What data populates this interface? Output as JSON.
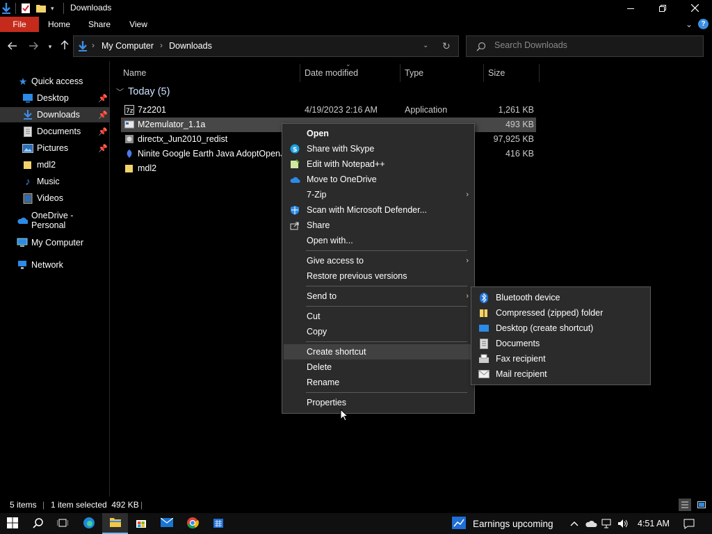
{
  "window": {
    "title": "Downloads",
    "minimize_icon": "minimize-icon",
    "maximize_icon": "restore-icon",
    "close_icon": "close-icon"
  },
  "ribbon": {
    "tabs": [
      "File",
      "Home",
      "Share",
      "View"
    ],
    "file_tab_color": "#c42b1c"
  },
  "address": {
    "crumbs": [
      "My Computer",
      "Downloads"
    ],
    "search_placeholder": "Search Downloads"
  },
  "sidebar": {
    "items": [
      {
        "label": "Quick access",
        "icon": "star-icon",
        "pinned": false
      },
      {
        "label": "Desktop",
        "icon": "desktop-icon",
        "pinned": true
      },
      {
        "label": "Downloads",
        "icon": "download-icon",
        "pinned": true,
        "selected": true
      },
      {
        "label": "Documents",
        "icon": "documents-icon",
        "pinned": true
      },
      {
        "label": "Pictures",
        "icon": "pictures-icon",
        "pinned": true
      },
      {
        "label": "mdl2",
        "icon": "folder-icon",
        "pinned": false
      },
      {
        "label": "Music",
        "icon": "music-icon",
        "pinned": false
      },
      {
        "label": "Videos",
        "icon": "videos-icon",
        "pinned": false
      },
      {
        "label": "OneDrive - Personal",
        "icon": "onedrive-icon",
        "pinned": false
      },
      {
        "label": "My Computer",
        "icon": "computer-icon",
        "pinned": false
      },
      {
        "label": "Network",
        "icon": "network-icon",
        "pinned": false
      }
    ]
  },
  "columns": {
    "name": "Name",
    "date": "Date modified",
    "type": "Type",
    "size": "Size"
  },
  "group": {
    "label": "Today (5)"
  },
  "files": [
    {
      "name": "7z2201",
      "date": "4/19/2023 2:16 AM",
      "type": "Application",
      "size": "1,261 KB",
      "icon": "7zip-icon"
    },
    {
      "name": "M2emulator_1.1a",
      "date": "",
      "type": "",
      "size": "493 KB",
      "icon": "archive-icon",
      "selected": true
    },
    {
      "name": "directx_Jun2010_redist",
      "date": "",
      "type": "",
      "size": "97,925 KB",
      "icon": "installer-icon"
    },
    {
      "name": "Ninite Google Earth Java AdoptOpenJDK",
      "date": "",
      "type": "",
      "size": "416 KB",
      "icon": "ninite-icon"
    },
    {
      "name": "mdl2",
      "date": "",
      "type": "",
      "size": "",
      "icon": "folder-icon"
    }
  ],
  "context_menu": {
    "items": {
      "open": "Open",
      "skype": "Share with Skype",
      "notepad": "Edit with Notepad++",
      "onedrive": "Move to OneDrive",
      "zip7": "7-Zip",
      "defender": "Scan with Microsoft Defender...",
      "share": "Share",
      "open_with": "Open with...",
      "give_access": "Give access to",
      "restore": "Restore previous versions",
      "send_to": "Send to",
      "cut": "Cut",
      "copy": "Copy",
      "create_shortcut": "Create shortcut",
      "delete": "Delete",
      "rename": "Rename",
      "properties": "Properties"
    }
  },
  "send_to_menu": {
    "items": {
      "bluetooth": "Bluetooth device",
      "zip": "Compressed (zipped) folder",
      "desktop": "Desktop (create shortcut)",
      "documents": "Documents",
      "fax": "Fax recipient",
      "mail": "Mail recipient"
    }
  },
  "status": {
    "count": "5 items",
    "selection": "1 item selected  492 KB"
  },
  "taskbar": {
    "news": "Earnings upcoming",
    "clock": "4:51 AM"
  }
}
